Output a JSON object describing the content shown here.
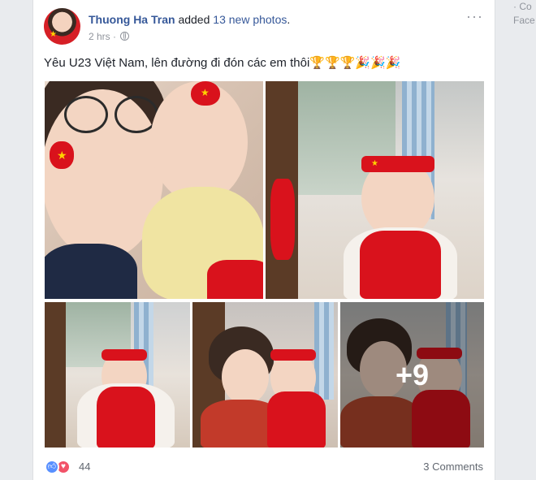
{
  "sidebar_fragment": {
    "line1": "· Co",
    "line2": "Face"
  },
  "post": {
    "author": "Thuong Ha Tran",
    "action_pre": " added ",
    "action_count": "13 new photos",
    "action_post": ".",
    "time": "2 hrs",
    "separator": " · ",
    "more_label": "···",
    "message": "Yêu U23 Việt Nam, lên đường đi đón các em thôi🏆🏆🏆🎉🎉🎉",
    "extra_photos_label": "+9"
  },
  "footer": {
    "reaction_count": "44",
    "comments_label": "3 Comments"
  },
  "icons": {
    "like": "thumbs-up-icon",
    "love": "heart-icon",
    "privacy": "globe-icon",
    "more": "more-options-icon"
  },
  "colors": {
    "author_link": "#365899",
    "like_blue": "#5890ff",
    "love_red": "#f25268",
    "flag_red": "#d9121c",
    "flag_star": "#ffd200"
  }
}
